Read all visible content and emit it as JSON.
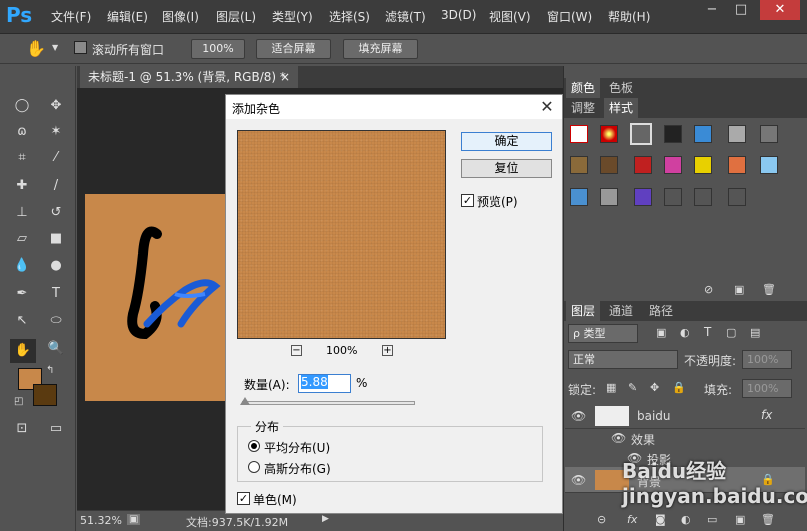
{
  "menubar": {
    "logo": "Ps",
    "items": [
      "文件(F)",
      "编辑(E)",
      "图像(I)",
      "图层(L)",
      "类型(Y)",
      "选择(S)",
      "滤镜(T)",
      "3D(D)",
      "视图(V)",
      "窗口(W)",
      "帮助(H)"
    ]
  },
  "window_controls": {
    "minimize": "−",
    "maximize": "□",
    "close": "✕"
  },
  "options_bar": {
    "scroll_all_label": "滚动所有窗口",
    "zoom_100": "100%",
    "fit_screen": "适合屏幕",
    "fill_screen": "填充屏幕"
  },
  "document": {
    "tab_title": "未标题-1 @ 51.3% (背景, RGB/8) *",
    "tab_close": "×",
    "canvas_color": "#c8884a"
  },
  "status_bar": {
    "zoom": "51.32%",
    "doc_info": "文档:937.5K/1.92M"
  },
  "dialog": {
    "title": "添加杂色",
    "close": "✕",
    "ok": "确定",
    "reset": "复位",
    "preview_label": "预览(P)",
    "preview_checked": true,
    "zoom_minus": "−",
    "zoom_plus": "+",
    "zoom_level": "100%",
    "amount_label": "数量(A):",
    "amount_value": "5.88",
    "amount_unit": "%",
    "distribution_label": "分布",
    "uniform_label": "平均分布(U)",
    "gaussian_label": "高斯分布(G)",
    "selected_distribution": "uniform",
    "monochromatic_label": "单色(M)",
    "monochromatic_checked": true
  },
  "panels": {
    "color_tabs": [
      "颜色",
      "色板"
    ],
    "style_tabs": [
      "调整",
      "样式"
    ],
    "layer_tabs": [
      "图层",
      "通道",
      "路径"
    ],
    "filter_kind": "ρ 类型",
    "blend_mode": "正常",
    "opacity_label": "不透明度:",
    "opacity_value": "100%",
    "lock_label": "锁定:",
    "fill_label": "填充:",
    "fill_value": "100%",
    "layers": [
      {
        "name": "baidu",
        "fx": "fx"
      },
      {
        "name": "效果"
      },
      {
        "name": "投影"
      },
      {
        "name": "背景"
      }
    ]
  },
  "colors": {
    "foreground": "#c8884a",
    "background": "#5a3a10",
    "accent": "#3b7fd1"
  },
  "watermark": "Baidu经验 jingyan.baidu.com"
}
